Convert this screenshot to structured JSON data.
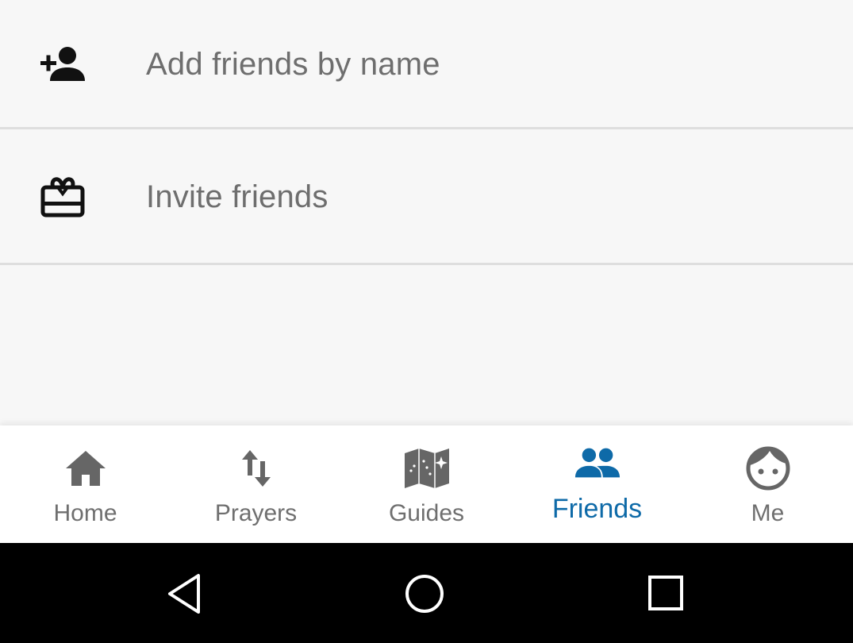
{
  "list": {
    "items": [
      {
        "label": "Add friends by name",
        "icon": "add-person-icon"
      },
      {
        "label": "Invite friends",
        "icon": "gift-card-icon"
      }
    ]
  },
  "bottom_nav": {
    "items": [
      {
        "label": "Home",
        "icon": "home-icon",
        "active": false
      },
      {
        "label": "Prayers",
        "icon": "swap-arrows-icon",
        "active": false
      },
      {
        "label": "Guides",
        "icon": "map-icon",
        "active": false
      },
      {
        "label": "Friends",
        "icon": "people-icon",
        "active": true
      },
      {
        "label": "Me",
        "icon": "face-icon",
        "active": false
      }
    ]
  },
  "system_nav": {
    "buttons": [
      "back-triangle-icon",
      "home-circle-icon",
      "recents-square-icon"
    ]
  },
  "colors": {
    "active": "#0e6aa8",
    "inactive": "#6f6f6f",
    "list_text": "#6e6e6e",
    "icon_dark": "#111111",
    "system_bar": "#000000"
  }
}
